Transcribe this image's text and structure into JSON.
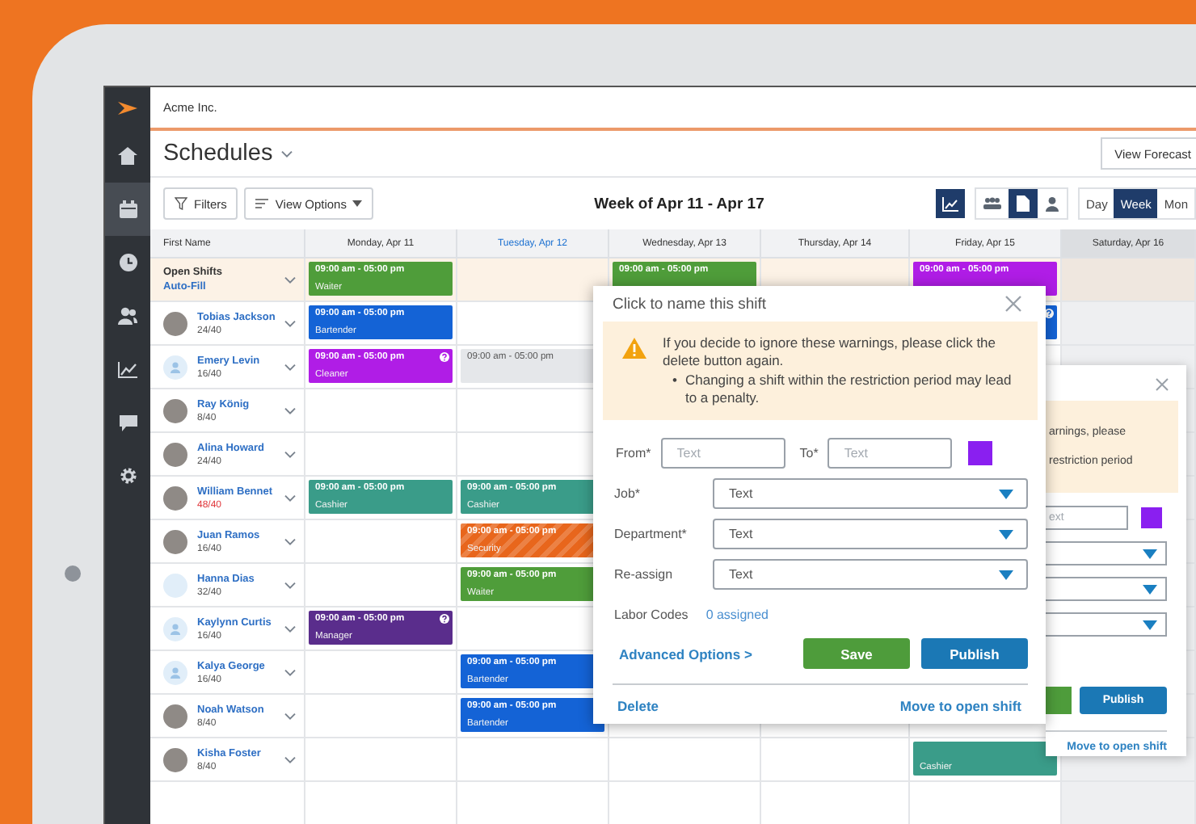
{
  "sidebar": {
    "items": [
      {
        "selected": false
      },
      {
        "selected": true
      },
      {
        "selected": false
      },
      {
        "selected": false
      },
      {
        "selected": false
      },
      {
        "selected": false
      },
      {
        "selected": false
      }
    ]
  },
  "company": "Acme Inc.",
  "page_title": "Schedules",
  "view_forecast": "View Forecast",
  "toolbar": {
    "filters": "Filters",
    "view_options": "View Options",
    "week_title": "Week of Apr 11 - Apr 17",
    "view_icons": [
      {
        "selected": true
      },
      {
        "selected": false
      },
      {
        "selected": true
      },
      {
        "selected": false
      }
    ],
    "ranges": [
      {
        "label": "Day",
        "selected": false
      },
      {
        "label": "Week",
        "selected": true
      },
      {
        "label": "Mon",
        "selected": false
      }
    ]
  },
  "grid": {
    "name_column": "First Name",
    "days": [
      {
        "label": "Monday, Apr 11",
        "today": false,
        "weekend": false
      },
      {
        "label": "Tuesday, Apr 12",
        "today": true,
        "weekend": false
      },
      {
        "label": "Wednesday, Apr 13",
        "today": false,
        "weekend": false
      },
      {
        "label": "Thursday, Apr 14",
        "today": false,
        "weekend": false
      },
      {
        "label": "Friday, Apr 15",
        "today": false,
        "weekend": false
      },
      {
        "label": "Saturday, Apr 16",
        "today": false,
        "weekend": true
      }
    ],
    "open_shifts": {
      "label": "Open Shifts",
      "action": "Auto-Fill",
      "cells": [
        {
          "kind": "assigned",
          "color": "#4f9d3a",
          "alert": false,
          "time": "09:00 am - 05:00 pm",
          "role": "Waiter"
        },
        null,
        {
          "kind": "assigned",
          "color": "#4f9d3a",
          "alert": false,
          "time": "09:00 am - 05:00 pm"
        },
        null,
        {
          "kind": "assigned",
          "color": "#b01de6",
          "alert": false,
          "time": "09:00 am - 05:00 pm"
        },
        null
      ]
    },
    "employees": [
      {
        "name": "Tobias Jackson",
        "hours": "24/40",
        "over": false,
        "avatar": {
          "kind": "photo"
        },
        "cells": [
          {
            "kind": "assigned",
            "color": "#1463d6",
            "alert": false,
            "time": "09:00 am - 05:00 pm",
            "role": "Bartender"
          },
          null,
          null,
          null,
          {
            "kind": "assigned",
            "color": "#1463d6",
            "alert": true
          },
          null
        ]
      },
      {
        "name": "Emery Levin",
        "hours": "16/40",
        "over": false,
        "avatar": {
          "kind": "generic"
        },
        "cells": [
          {
            "kind": "assigned",
            "color": "#b01de6",
            "alert": true,
            "time": "09:00 am - 05:00 pm",
            "role": "Cleaner"
          },
          {
            "kind": "draft",
            "color": "#e5e7ea",
            "alert": false,
            "time": "09:00 am - 05:00 pm"
          },
          null,
          null,
          null,
          null
        ]
      },
      {
        "name": "Ray König",
        "hours": "8/40",
        "over": false,
        "avatar": {
          "kind": "photo"
        }
      },
      {
        "name": "Alina Howard",
        "hours": "24/40",
        "over": false,
        "avatar": {
          "kind": "photo"
        }
      },
      {
        "name": "William Bennet",
        "hours": "48/40",
        "over": true,
        "avatar": {
          "kind": "photo"
        },
        "cells": [
          {
            "kind": "assigned",
            "color": "#3a9c89",
            "alert": false,
            "time": "09:00 am - 05:00 pm",
            "role": "Cashier"
          },
          {
            "kind": "assigned",
            "color": "#3a9c89",
            "alert": false,
            "time": "09:00 am - 05:00 pm",
            "role": "Cashier"
          },
          null,
          null,
          null,
          null
        ]
      },
      {
        "name": "Juan Ramos",
        "hours": "16/40",
        "over": false,
        "avatar": {
          "kind": "photo"
        },
        "cells": [
          null,
          {
            "kind": "restricted",
            "color": "#e8661c",
            "alert": false,
            "time": "09:00 am - 05:00 pm",
            "role": "Security"
          },
          null,
          null,
          null,
          null
        ]
      },
      {
        "name": "Hanna Dias",
        "hours": "32/40",
        "over": false,
        "avatar": {
          "kind": "blank"
        },
        "cells": [
          null,
          {
            "kind": "assigned",
            "color": "#4f9d3a",
            "alert": false,
            "time": "09:00 am - 05:00 pm",
            "role": "Waiter"
          },
          null,
          null,
          null,
          null
        ]
      },
      {
        "name": "Kaylynn Curtis",
        "hours": "16/40",
        "over": false,
        "avatar": {
          "kind": "generic"
        },
        "cells": [
          {
            "kind": "assigned",
            "color": "#5a2d8c",
            "alert": true,
            "time": "09:00 am - 05:00 pm",
            "role": "Manager"
          },
          null,
          null,
          null,
          null,
          null
        ]
      },
      {
        "name": "Kalya George",
        "hours": "16/40",
        "over": false,
        "avatar": {
          "kind": "generic"
        },
        "cells": [
          null,
          {
            "kind": "assigned",
            "color": "#1463d6",
            "alert": false,
            "time": "09:00 am - 05:00 pm",
            "role": "Bartender"
          },
          null,
          null,
          null,
          null
        ]
      },
      {
        "name": "Noah Watson",
        "hours": "8/40",
        "over": false,
        "avatar": {
          "kind": "photo"
        },
        "cells": [
          null,
          {
            "kind": "assigned",
            "color": "#1463d6",
            "alert": false,
            "time": "09:00 am - 05:00 pm",
            "role": "Bartender"
          },
          null,
          null,
          null,
          null
        ]
      },
      {
        "name": "Kisha Foster",
        "hours": "8/40",
        "over": false,
        "avatar": {
          "kind": "photo"
        },
        "cells": [
          null,
          null,
          null,
          null,
          {
            "kind": "assigned",
            "color": "#3a9c89",
            "alert": false,
            "role": "Cashier"
          },
          null
        ]
      }
    ]
  },
  "back_dialog": {
    "warning_lines": [
      "arnings, please",
      "restriction period"
    ],
    "to_placeholder": "ext",
    "color": "#8a1ff0",
    "publish": "Publish",
    "move": "Move to open shift"
  },
  "dialog": {
    "title": "Click to name this shift",
    "warning": {
      "message": "If you decide to ignore these warnings, please click the delete button again.",
      "bullets": [
        {
          "marker": "•",
          "text": "Changing a shift within the restriction period may lead to a penalty."
        }
      ]
    },
    "from_label": "From*",
    "from_placeholder": "Text",
    "to_label": "To*",
    "to_placeholder": "Text",
    "color": "#8a1ff0",
    "selects": [
      {
        "label": "Job*",
        "value": "Text"
      },
      {
        "label": "Department*",
        "value": "Text"
      },
      {
        "label": "Re-assign",
        "value": "Text"
      }
    ],
    "labor_label": "Labor Codes",
    "labor_value": "0 assigned",
    "advanced": "Advanced Options >",
    "save": "Save",
    "publish": "Publish",
    "delete": "Delete",
    "move": "Move to open shift"
  }
}
